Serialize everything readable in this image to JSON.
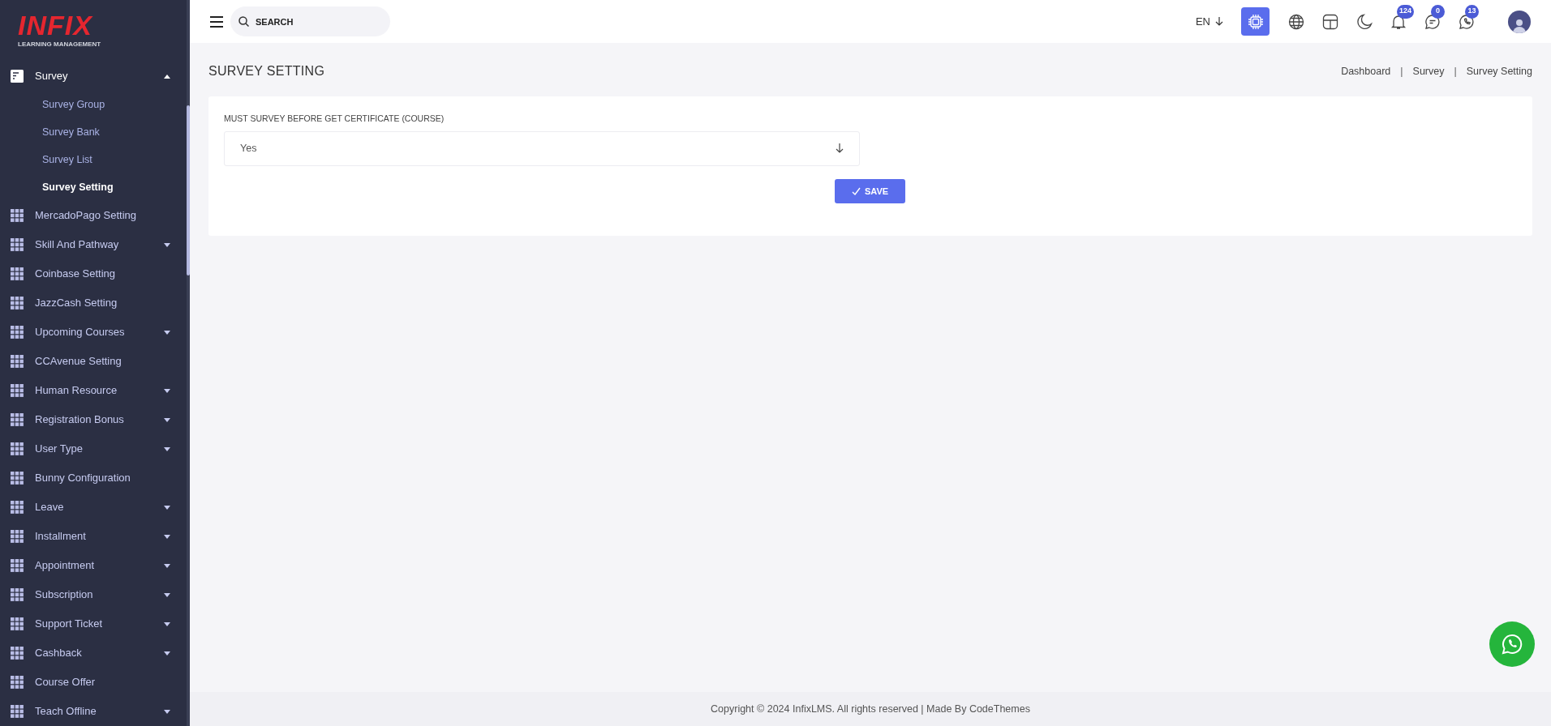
{
  "logo": {
    "wordmark": "INFIX",
    "tagline": "LEARNING MANAGEMENT"
  },
  "sidebar": {
    "items": [
      {
        "label": "Survey",
        "kind": "menu",
        "expanded": true,
        "children": [
          {
            "label": "Survey Group",
            "selected": false
          },
          {
            "label": "Survey Bank",
            "selected": false
          },
          {
            "label": "Survey List",
            "selected": false
          },
          {
            "label": "Survey Setting",
            "selected": true
          }
        ]
      },
      {
        "label": "MercadoPago Setting",
        "kind": "link"
      },
      {
        "label": "Skill And Pathway",
        "kind": "menu",
        "expanded": false
      },
      {
        "label": "Coinbase Setting",
        "kind": "link"
      },
      {
        "label": "JazzCash Setting",
        "kind": "link"
      },
      {
        "label": "Upcoming Courses",
        "kind": "menu",
        "expanded": false
      },
      {
        "label": "CCAvenue Setting",
        "kind": "link"
      },
      {
        "label": "Human Resource",
        "kind": "menu",
        "expanded": false
      },
      {
        "label": "Registration Bonus",
        "kind": "menu",
        "expanded": false
      },
      {
        "label": "User Type",
        "kind": "menu",
        "expanded": false
      },
      {
        "label": "Bunny Configuration",
        "kind": "link"
      },
      {
        "label": "Leave",
        "kind": "menu",
        "expanded": false
      },
      {
        "label": "Installment",
        "kind": "menu",
        "expanded": false
      },
      {
        "label": "Appointment",
        "kind": "menu",
        "expanded": false
      },
      {
        "label": "Subscription",
        "kind": "menu",
        "expanded": false
      },
      {
        "label": "Support Ticket",
        "kind": "menu",
        "expanded": false
      },
      {
        "label": "Cashback",
        "kind": "menu",
        "expanded": false
      },
      {
        "label": "Course Offer",
        "kind": "link"
      },
      {
        "label": "Teach Offline",
        "kind": "menu",
        "expanded": false
      }
    ]
  },
  "topbar": {
    "search": {
      "placeholder": "SEARCH"
    },
    "language": "EN",
    "icons": [
      {
        "kind": "ai"
      },
      {
        "kind": "globe"
      },
      {
        "kind": "layout"
      },
      {
        "kind": "moon"
      },
      {
        "kind": "bell",
        "badge": "124"
      },
      {
        "kind": "chat",
        "badge": "0"
      },
      {
        "kind": "whatsapp",
        "badge": "13"
      },
      {
        "kind": "avatar"
      }
    ]
  },
  "page": {
    "title": "SURVEY SETTING",
    "breadcrumb": [
      {
        "label": "Dashboard"
      },
      {
        "separator": "|",
        "label": "Survey"
      },
      {
        "separator": "|",
        "label": "Survey Setting"
      }
    ]
  },
  "form": {
    "field": {
      "label": "MUST SURVEY BEFORE GET CERTIFICATE (COURSE)",
      "value": "Yes"
    },
    "save_button": "SAVE"
  },
  "footer": "Copyright © 2024 InfixLMS. All rights reserved | Made By CodeThemes"
}
